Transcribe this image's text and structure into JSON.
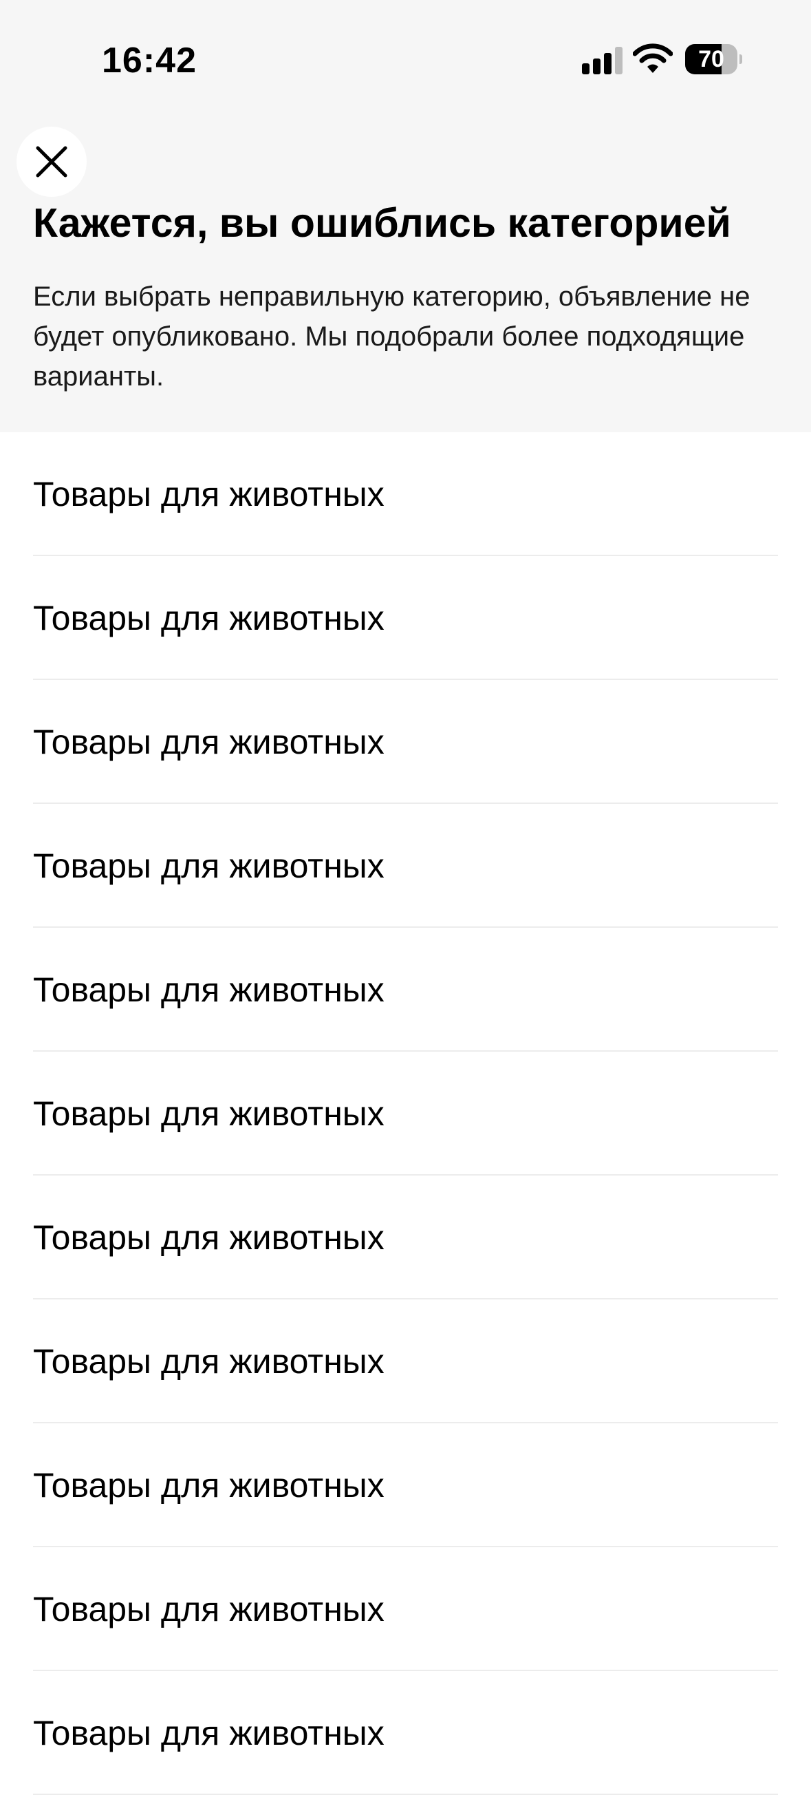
{
  "status_bar": {
    "time": "16:42",
    "battery_percent": "70",
    "battery_level": 0.7
  },
  "header": {
    "close_icon": "close-icon",
    "title": "Кажется, вы ошиблись категорией",
    "description": "Если выбрать неправильную категорию, объявление не будет опубликовано. Мы подобрали более подходящие варианты."
  },
  "categories": [
    {
      "label": "Товары для животных"
    },
    {
      "label": "Товары для животных"
    },
    {
      "label": "Товары для животных"
    },
    {
      "label": "Товары для животных"
    },
    {
      "label": "Товары для животных"
    },
    {
      "label": "Товары для животных"
    },
    {
      "label": "Товары для животных"
    },
    {
      "label": "Товары для животных"
    },
    {
      "label": "Товары для животных"
    },
    {
      "label": "Товары для животных"
    },
    {
      "label": "Товары для животных"
    }
  ],
  "colors": {
    "header_background": "#f6f6f6",
    "page_background": "#ffffff",
    "divider": "#ececec",
    "text": "#000000"
  }
}
